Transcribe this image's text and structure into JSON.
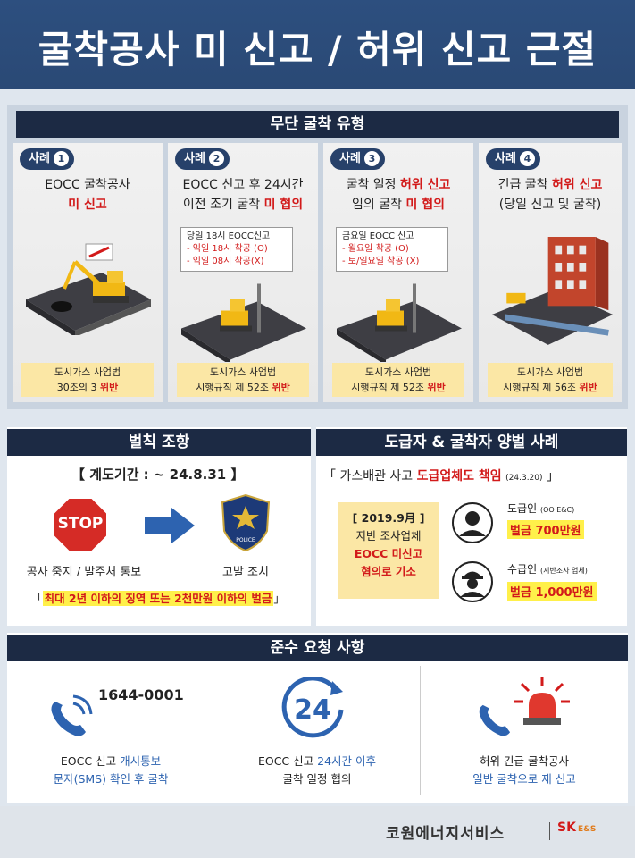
{
  "title": "굴착공사 미 신고 / 허위 신고 근절",
  "sections": {
    "types": "무단 굴착 유형",
    "penalty": "벌칙 조항",
    "contractor": "도급자 & 굴착자 양벌 사례",
    "compliance": "준수 요청 사항"
  },
  "cases": [
    {
      "badge": "사례",
      "num": "1",
      "line1": "EOCC 굴착공사",
      "line2_red": "미 신고",
      "line2_pre": "",
      "law1": "도시가스 사업법",
      "law2_pre": "30조의 3",
      "law2_red": "위반"
    },
    {
      "badge": "사례",
      "num": "2",
      "line1": "EOCC 신고 후 24시간",
      "line2_pre": "이전 조기 굴착",
      "line2_red": "미 협의",
      "note_title": "당일 18시 EOCC신고",
      "note_a": "- 익일 18시 착공 (O)",
      "note_b": "- 익일 08시 착공(X)",
      "law1": "도시가스 사업법",
      "law2_pre": "시행규칙 제 52조",
      "law2_red": "위반"
    },
    {
      "badge": "사례",
      "num": "3",
      "line1_pre": "굴착 일정",
      "line1_red": "허위 신고",
      "line2_pre": "임의 굴착",
      "line2_red": "미 협의",
      "note_title": "금요일 EOCC 신고",
      "note_a": "- 월요일 착공 (O)",
      "note_b": "- 토/일요일 착공 (X)",
      "law1": "도시가스 사업법",
      "law2_pre": "시행규칙 제 52조",
      "law2_red": "위반"
    },
    {
      "badge": "사례",
      "num": "4",
      "line1_pre": "긴급 굴착",
      "line1_red": "허위 신고",
      "line2_pre": "(당일 신고 및 굴착)",
      "line2_red": "",
      "law1": "도시가스 사업법",
      "law2_pre": "시행규칙 제 56조",
      "law2_red": "위반"
    }
  ],
  "penalty": {
    "grace": "【 계도기간 : ~ 24.8.31 】",
    "stop_sign": "STOP",
    "stop_label": "공사 중지 / 발주처 통보",
    "police_label": "고발 조치",
    "police_badge": "POLICE",
    "fine_note": "최대 2년 이하의 징역 또는 2천만원 이하의 벌금"
  },
  "contractor": {
    "headline_pre": "「 가스배관 사고",
    "headline_red": "도급업체도 책임",
    "headline_date": "(24.3.20)",
    "headline_post": "」",
    "case_date": "[ 2019.9月 ]",
    "case_line1": "지반 조사업체",
    "case_line2": "EOCC 미신고",
    "case_line3": "혐의로 기소",
    "contractor_label": "도급인",
    "contractor_sub": "(OO E&C)",
    "contractor_fine": "벌금 700만원",
    "subcontractor_label": "수급인",
    "subcontractor_sub": "(지반조사 업체)",
    "subcontractor_fine": "벌금 1,000만원"
  },
  "compliance": {
    "phone_number": "1644-0001",
    "item1_line1_pre": "EOCC 신고",
    "item1_line1_blue": "개시통보",
    "item1_line2": "문자(SMS) 확인 후 굴착",
    "clock_text": "24",
    "item2_line1_pre": "EOCC 신고",
    "item2_line1_blue": "24시간 이후",
    "item2_line2": "굴착 일정 협의",
    "item3_line1": "허위 긴급 굴착공사",
    "item3_line2": "일반 굴착으로 재 신고"
  },
  "footer": {
    "company": "코원에너지서비스",
    "brand": "SK",
    "brand_sub": "E&S"
  }
}
